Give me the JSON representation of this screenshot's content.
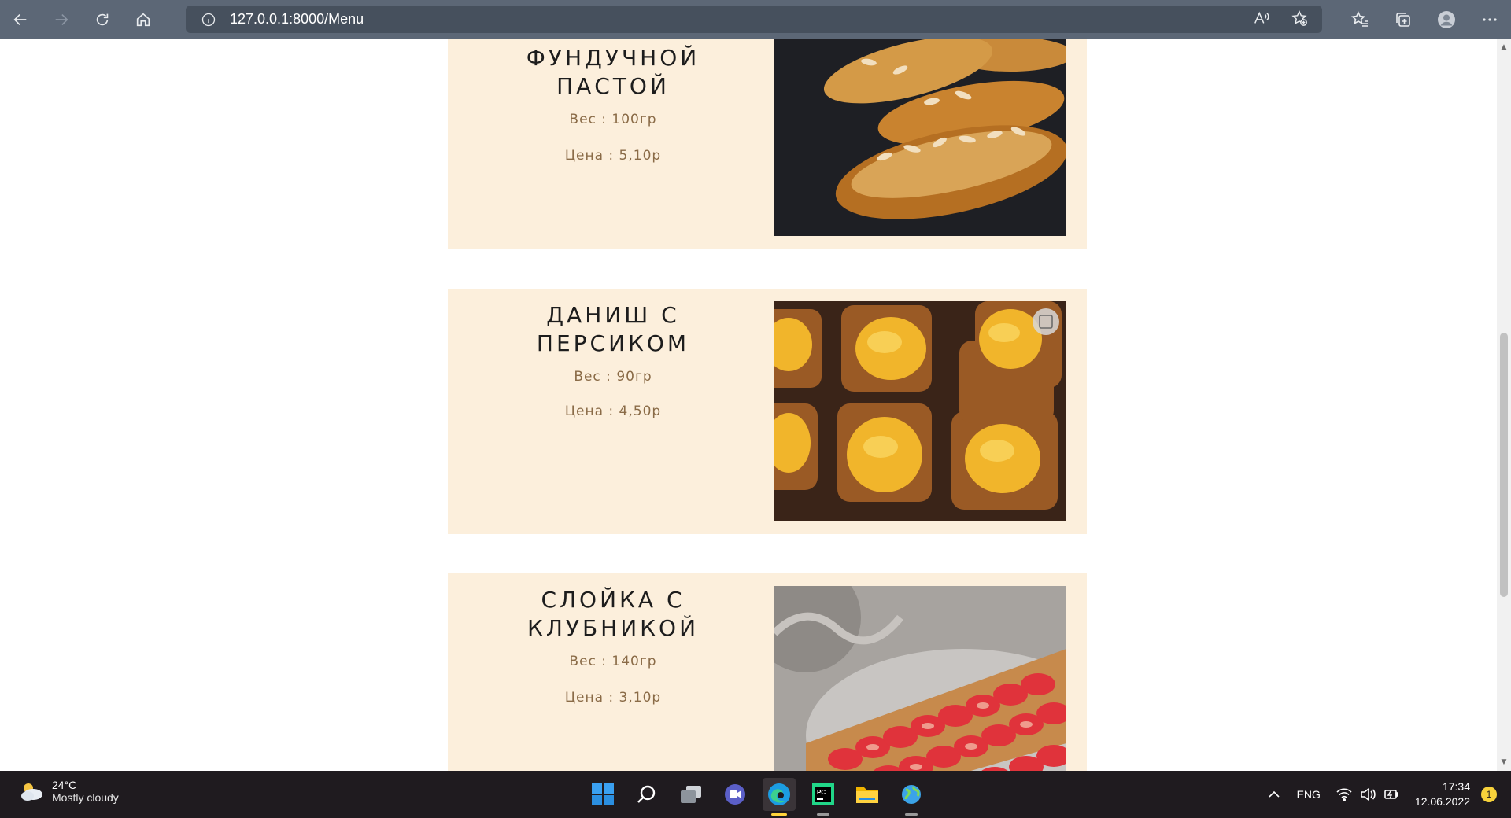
{
  "browser": {
    "url": "127.0.0.1:8000/Menu"
  },
  "menu": {
    "items": [
      {
        "name": "ФУНДУЧНОЙ ПАСТОЙ",
        "name_lines": [
          "ФУНДУЧНОЙ",
          "ПАСТОЙ"
        ],
        "weight": "Вес : 100гр",
        "price": "Цена : 5,10р",
        "image": "almond-croissant-photo"
      },
      {
        "name": "ДАНИШ С ПЕРСИКОМ",
        "name_lines": [
          "ДАНИШ С",
          "ПЕРСИКОМ"
        ],
        "weight": "Вес : 90гр",
        "price": "Цена : 4,50р",
        "image": "peach-danish-photo"
      },
      {
        "name": "СЛОЙКА С КЛУБНИКОЙ",
        "name_lines": [
          "СЛОЙКА С",
          "КЛУБНИКОЙ"
        ],
        "weight": "Вес : 140гр",
        "price": "Цена : 3,10р",
        "image": "strawberry-puff-photo"
      }
    ]
  },
  "taskbar": {
    "weather_temp": "24°C",
    "weather_desc": "Mostly cloudy",
    "language": "ENG",
    "time": "17:34",
    "date": "12.06.2022",
    "notifications": "1"
  },
  "colors": {
    "card_bg": "#fcefdc",
    "meta_text": "#8a6b47",
    "chrome": "#5c6776"
  }
}
